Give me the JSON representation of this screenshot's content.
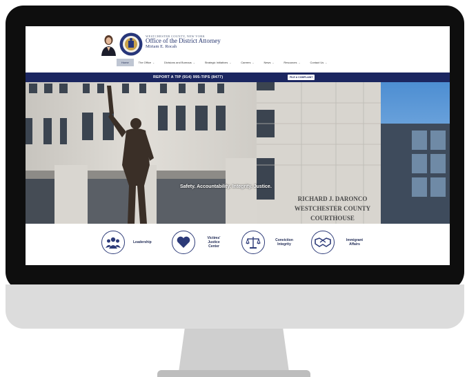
{
  "header": {
    "county": "WESTCHESTER COUNTY, NEW YORK",
    "office": "Office of the District Attorney",
    "da_name": "Miriam E. Rocah"
  },
  "nav": {
    "items": [
      {
        "label": "Home",
        "active": true
      },
      {
        "label": "The Office"
      },
      {
        "label": "Divisions and Bureaus"
      },
      {
        "label": "Strategic Initiatives"
      },
      {
        "label": "Careers"
      },
      {
        "label": "News"
      },
      {
        "label": "Resources"
      },
      {
        "label": "Contact Us"
      }
    ]
  },
  "tipbar": {
    "text": "REPORT A TIP (914) 995-TIPS (8477)",
    "button": "FILE A COMPLAINT"
  },
  "hero": {
    "tagline": "Safety. Accountability. Integrity. Justice.",
    "building_line1": "RICHARD J. DARONCO",
    "building_line2": "WESTCHESTER COUNTY",
    "building_line3": "COURTHOUSE"
  },
  "features": [
    {
      "label": "Leadership",
      "icon": "people-icon"
    },
    {
      "label": "Victims' Justice Center",
      "icon": "heart-icon"
    },
    {
      "label": "Conviction Integrity",
      "icon": "scales-icon"
    },
    {
      "label": "Immigrant Affairs",
      "icon": "handshake-icon"
    }
  ],
  "colors": {
    "navy": "#1b2660",
    "accent": "#2c3a78",
    "stone": "#d6d3cd"
  }
}
